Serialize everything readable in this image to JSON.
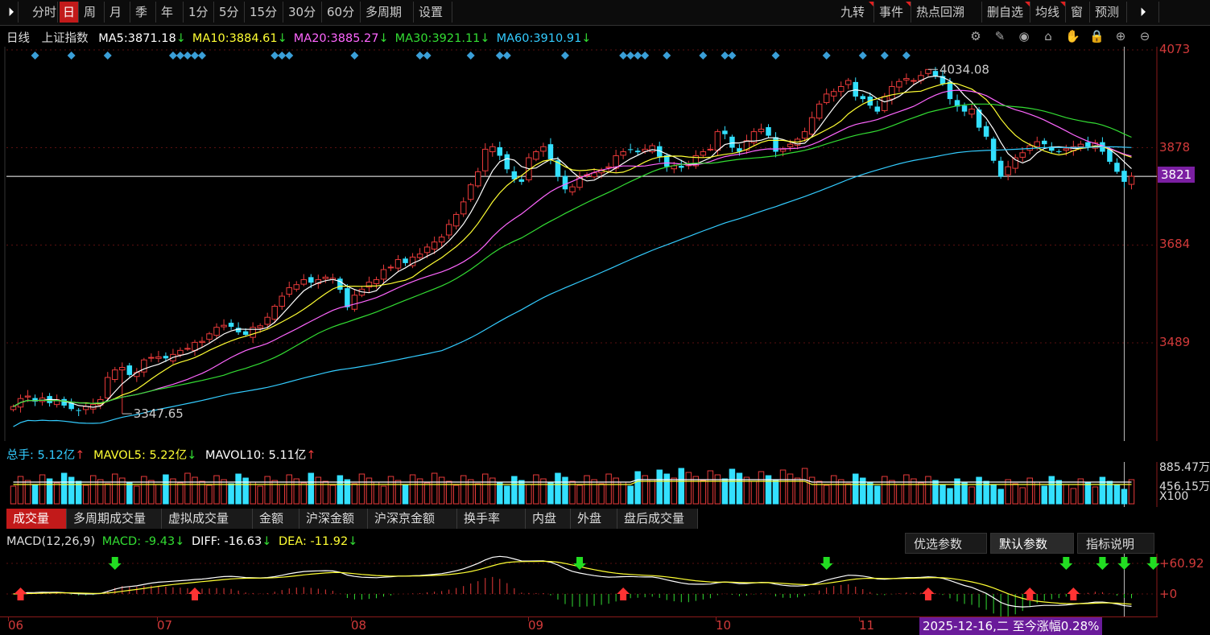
{
  "toolbar": {
    "left_tabs": [
      "分时",
      "日",
      "周",
      "月",
      "季",
      "年",
      "1分",
      "5分",
      "15分",
      "30分",
      "60分",
      "多周期",
      "设置"
    ],
    "right_tabs": [
      "九转",
      "事件",
      "热点回溯",
      "删自选",
      "均线",
      "窗",
      "预测"
    ],
    "active": "日"
  },
  "main": {
    "period": "日线",
    "index_name": "上证指数",
    "ma": [
      {
        "label": "MA5:",
        "value": "3871.18",
        "arrow": "↓",
        "color": "#ffffff"
      },
      {
        "label": "MA10:",
        "value": "3884.61",
        "arrow": "↓",
        "color": "#ffff33"
      },
      {
        "label": "MA20:",
        "value": "3885.27",
        "arrow": "↓",
        "color": "#ff66ff"
      },
      {
        "label": "MA30:",
        "value": "3921.11",
        "arrow": "↓",
        "color": "#33dd33"
      },
      {
        "label": "MA60:",
        "value": "3910.91",
        "arrow": "↓",
        "color": "#33ccff"
      }
    ],
    "high_label": "4034.08",
    "low_label": "3347.65",
    "y_ticks": [
      "4073",
      "3878",
      "3684",
      "3489"
    ],
    "current_price": "3821",
    "icons": [
      "settings-icon",
      "pen-icon",
      "eye-icon",
      "bank-icon",
      "hand-icon",
      "lock-icon",
      "zoom-in-icon",
      "zoom-out-icon"
    ]
  },
  "volume": {
    "label_total": "总手:",
    "total": "5.12亿",
    "total_arrow": "↑",
    "mavol5_label": "MAVOL5:",
    "mavol5": "5.22亿",
    "mavol5_arrow": "↓",
    "mavol10_label": "MAVOL10:",
    "mavol10": "5.11亿",
    "mavol10_arrow": "↑",
    "y_ticks": [
      "885.47万",
      "456.15万"
    ],
    "unit": "X100"
  },
  "volume_tabs": [
    "成交量",
    "多周期成交量",
    "虚拟成交量",
    "金额",
    "沪深金额",
    "沪深京金额",
    "换手率",
    "内盘",
    "外盘",
    "盘后成交量"
  ],
  "macd": {
    "title": "MACD(12,26,9)",
    "macd_label": "MACD:",
    "macd_value": "-9.43",
    "diff_label": "DIFF:",
    "diff_value": "-16.63",
    "dea_label": "DEA:",
    "dea_value": "-11.92",
    "arrow": "↓",
    "y_ticks": [
      "+60.92",
      "+0"
    ],
    "buttons": [
      "优选参数",
      "默认参数",
      "指标说明"
    ]
  },
  "x_axis": {
    "labels": [
      "06",
      "07",
      "08",
      "09",
      "10",
      "11"
    ],
    "status": "2025-12-16,二 至今涨幅0.28%"
  },
  "chart_data": {
    "type": "candlestick",
    "title": "上证指数 日线",
    "ylim": [
      3300,
      4100
    ],
    "months": [
      "06",
      "07",
      "08",
      "09",
      "10",
      "11"
    ],
    "high": 4034.08,
    "low": 3347.65,
    "last_close": 3821,
    "series": [
      {
        "name": "close",
        "values": [
          3362,
          3378,
          3383,
          3372,
          3379,
          3369,
          3376,
          3364,
          3357,
          3354,
          3362,
          3366,
          3376,
          3420,
          3435,
          3440,
          3425,
          3430,
          3455,
          3460,
          3461,
          3458,
          3466,
          3474,
          3478,
          3490,
          3492,
          3507,
          3520,
          3524,
          3521,
          3510,
          3505,
          3520,
          3523,
          3540,
          3562,
          3582,
          3599,
          3605,
          3615,
          3609,
          3615,
          3620,
          3618,
          3595,
          3560,
          3584,
          3596,
          3610,
          3615,
          3635,
          3640,
          3655,
          3648,
          3660,
          3666,
          3680,
          3690,
          3700,
          3725,
          3745,
          3770,
          3804,
          3830,
          3875,
          3880,
          3862,
          3835,
          3815,
          3810,
          3858,
          3870,
          3880,
          3855,
          3820,
          3795,
          3800,
          3820,
          3824,
          3828,
          3834,
          3840,
          3862,
          3870,
          3874,
          3869,
          3875,
          3882,
          3860,
          3840,
          3842,
          3838,
          3845,
          3862,
          3870,
          3875,
          3910,
          3905,
          3878,
          3870,
          3892,
          3910,
          3915,
          3902,
          3870,
          3875,
          3885,
          3895,
          3910,
          3938,
          3965,
          3985,
          3990,
          4000,
          4012,
          3980,
          3975,
          3962,
          3950,
          3980,
          4000,
          4010,
          4016,
          4012,
          4022,
          4034,
          4020,
          4005,
          3975,
          3960,
          3950,
          3955,
          3918,
          3900,
          3852,
          3820,
          3840,
          3858,
          3868,
          3882,
          3890,
          3885,
          3872,
          3870,
          3876,
          3880,
          3885,
          3880,
          3888,
          3870,
          3850,
          3830,
          3810,
          3821
        ]
      },
      {
        "name": "MA5",
        "color": "#ffffff"
      },
      {
        "name": "MA10",
        "color": "#ffff33"
      },
      {
        "name": "MA20",
        "color": "#ff66ff"
      },
      {
        "name": "MA30",
        "color": "#33dd33"
      },
      {
        "name": "MA60",
        "color": "#33ccff"
      }
    ],
    "colors": {
      "up": "#e83a3a",
      "down": "#33e0ff",
      "axis": "#8b1a1a",
      "grid": "#5a1010"
    }
  }
}
